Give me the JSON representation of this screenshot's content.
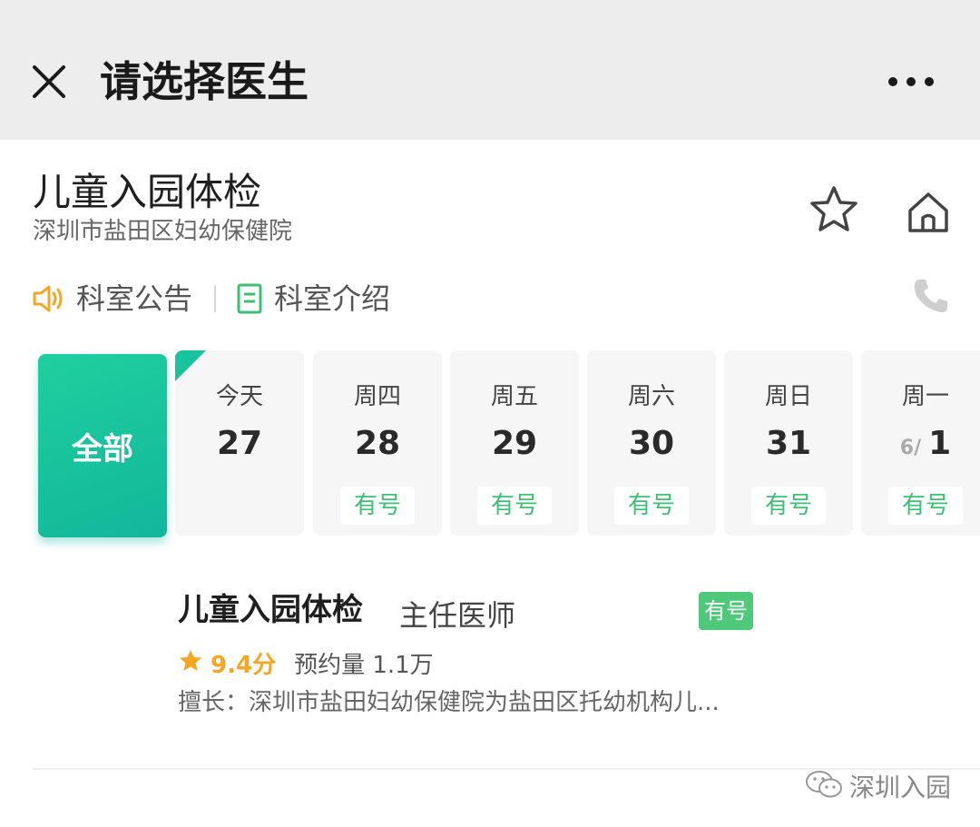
{
  "topbar": {
    "title": "请选择医生",
    "close_icon": "close-icon",
    "more_icon": "more-dots-icon"
  },
  "department": {
    "title": "儿童入园体检",
    "hospital": "深圳市盐田区妇幼保健院"
  },
  "actions": {
    "favorite_icon": "star-outline-icon",
    "home_icon": "home-icon",
    "phone_icon": "phone-icon"
  },
  "notices": {
    "announcement": "科室公告",
    "intro": "科室介绍"
  },
  "date_selector": {
    "all_label": "全部",
    "days": [
      {
        "weekday": "今天",
        "prefix": "",
        "date": "27",
        "badge": ""
      },
      {
        "weekday": "周四",
        "prefix": "",
        "date": "28",
        "badge": "有号"
      },
      {
        "weekday": "周五",
        "prefix": "",
        "date": "29",
        "badge": "有号"
      },
      {
        "weekday": "周六",
        "prefix": "",
        "date": "30",
        "badge": "有号"
      },
      {
        "weekday": "周日",
        "prefix": "",
        "date": "31",
        "badge": "有号"
      },
      {
        "weekday": "周一",
        "prefix": "6/",
        "date": "1",
        "badge": "有号"
      }
    ]
  },
  "doctor": {
    "name": "儿童入园体检",
    "title": "主任医师",
    "badge": "有号",
    "rating": "9.4分",
    "volume": "预约量 1.1万",
    "specialty": "擅长：深圳市盐田妇幼保健院为盐田区托幼机构儿..."
  },
  "watermark": {
    "text": "深圳入园"
  },
  "colors": {
    "accent": "#12b79a",
    "available": "#3dbf74",
    "rating": "#f5a623",
    "topbar_bg": "#ededed"
  }
}
